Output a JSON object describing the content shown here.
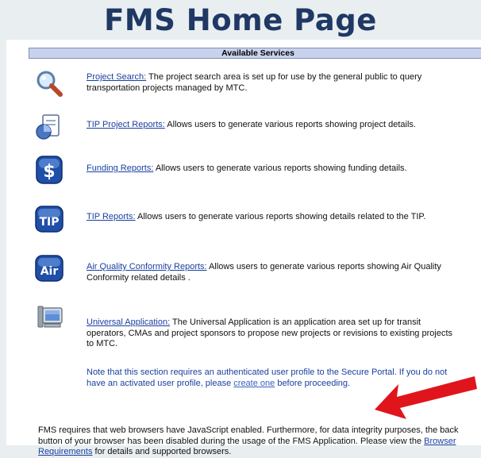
{
  "slide": {
    "title": "FMS Home Page"
  },
  "header": {
    "title": "Available Services"
  },
  "services": [
    {
      "link": "Project Search:",
      "text": " The project search area is set up for use by the general public to query transportation projects managed by MTC."
    },
    {
      "link": "TIP Project Reports:",
      "text": " Allows users to generate various reports showing project details."
    },
    {
      "link": "Funding Reports:",
      "text": " Allows users to generate various reports showing funding details.",
      "icon_label": "$"
    },
    {
      "link": "TIP Reports:",
      "text": " Allows users to generate various reports showing details related to the TIP.",
      "icon_label": "TIP"
    },
    {
      "link": "Air Quality Conformity Reports:",
      "text": " Allows users to generate various reports showing Air Quality Conformity related details .",
      "icon_label": "Air"
    },
    {
      "link": "Universal Application:",
      "text": " The Universal Application is an application area set up for transit operators, CMAs and project sponsors to propose new projects or revisions to existing projects to MTC."
    }
  ],
  "note": {
    "text_before": "Note that this section requires an authenticated user profile to ",
    "text_hidden": "th",
    "text_mid": "e Secure Portal. If you do not have an activated user profile, please ",
    "link": "create one",
    "text_after": " before proceeding."
  },
  "footer": {
    "text_before": "FMS requires that web browsers have JavaScript enabled. Furthermore, for data integrity purposes, the back button of your browser has been disabled during the usage of the FMS Application. Please view the ",
    "link": "Browser Requirements",
    "text_after": " for details and supported browsers."
  },
  "colors": {
    "title": "#1f3864",
    "header_bg": "#c8d2ec",
    "link": "#1a3fa0",
    "arrow": "#e0141b"
  },
  "icons": [
    "magnifier-icon",
    "reports-icon",
    "dollar-icon",
    "tip-icon",
    "air-icon",
    "computer-icon"
  ]
}
